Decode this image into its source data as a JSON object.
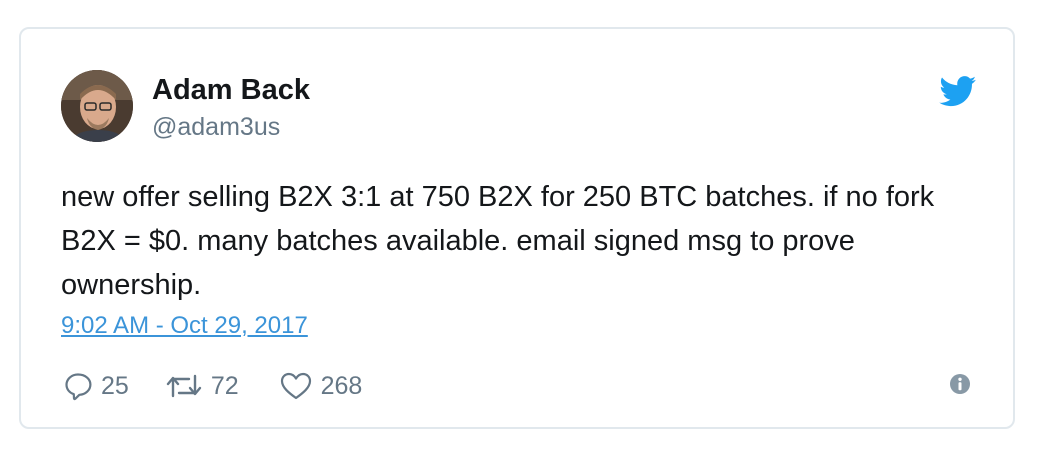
{
  "tweet": {
    "author": {
      "display_name": "Adam Back",
      "handle": "@adam3us"
    },
    "text": "new offer selling B2X 3:1 at 750 B2X for 250 BTC batches. if no fork B2X = $0. many batches available. email signed msg to prove ownership.",
    "timestamp": "9:02 AM - Oct 29, 2017",
    "counts": {
      "replies": "25",
      "retweets": "72",
      "likes": "268"
    }
  },
  "icons": {
    "brand": "twitter-bird-icon",
    "reply": "reply-bubble-icon",
    "retweet": "retweet-arrows-icon",
    "like": "heart-icon",
    "info": "info-icon"
  },
  "colors": {
    "brand_blue": "#1da1f2",
    "link_blue": "#3b94d9",
    "text_primary": "#14171a",
    "text_secondary": "#657786",
    "border": "#e1e8ed"
  }
}
